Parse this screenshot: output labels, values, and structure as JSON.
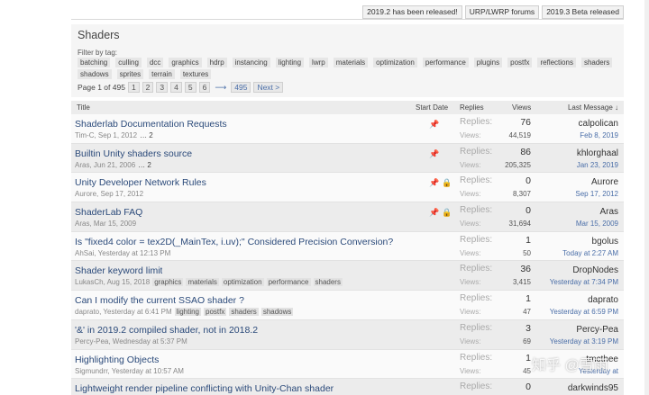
{
  "notices": [
    "2019.2 has been released!",
    "URP/LWRP forums",
    "2019.3 Beta released"
  ],
  "forum": {
    "title": "Shaders",
    "filter_label": "Filter by tag:",
    "tags": [
      "batching",
      "culling",
      "dcc",
      "graphics",
      "hdrp",
      "instancing",
      "lighting",
      "lwrp",
      "materials",
      "optimization",
      "performance",
      "plugins",
      "postfx",
      "reflections",
      "shaders",
      "shadows",
      "sprites",
      "terrain",
      "textures"
    ]
  },
  "pager": {
    "label": "Page 1 of 495",
    "pages": [
      "1",
      "2",
      "3",
      "4",
      "5",
      "6"
    ],
    "arrow": "⟶",
    "last": "495",
    "next": "Next >"
  },
  "columns": {
    "title": "Title",
    "start_date": "Start Date",
    "replies": "Replies",
    "views": "Views",
    "last_message": "Last Message ↓"
  },
  "labels": {
    "replies": "Replies:",
    "views": "Views:"
  },
  "threads": [
    {
      "title": "Shaderlab Documentation Requests",
      "meta": "Tim-C, Sep 1, 2012",
      "pages": "… 2",
      "tags": [],
      "pinned": true,
      "locked": false,
      "replies": "76",
      "views": "44,519",
      "last_user": "calpolican",
      "last_date": "Feb 8, 2019"
    },
    {
      "title": "Builtin Unity shaders source",
      "meta": "Aras, Jun 21, 2006",
      "pages": "… 2",
      "tags": [],
      "pinned": true,
      "locked": false,
      "replies": "86",
      "views": "205,325",
      "last_user": "khlorghaal",
      "last_date": "Jan 23, 2019"
    },
    {
      "title": "Unity Developer Network Rules",
      "meta": "Aurore, Sep 17, 2012",
      "pages": "",
      "tags": [],
      "pinned": true,
      "locked": true,
      "replies": "0",
      "views": "8,307",
      "last_user": "Aurore",
      "last_date": "Sep 17, 2012"
    },
    {
      "title": "ShaderLab FAQ",
      "meta": "Aras, Mar 15, 2009",
      "pages": "",
      "tags": [],
      "pinned": true,
      "locked": true,
      "replies": "0",
      "views": "31,694",
      "last_user": "Aras",
      "last_date": "Mar 15, 2009"
    },
    {
      "title": "Is \"fixed4 color = tex2D(_MainTex, i.uv);\" Considered Precision Conversion?",
      "meta": "AhSai, Yesterday at 12:13 PM",
      "pages": "",
      "tags": [],
      "pinned": false,
      "locked": false,
      "replies": "1",
      "views": "50",
      "last_user": "bgolus",
      "last_date": "Today at 2:27 AM"
    },
    {
      "title": "Shader keyword limit",
      "meta": "LukasCh, Aug 15, 2018",
      "pages": "",
      "tags": [
        "graphics",
        "materials",
        "optimization",
        "performance",
        "shaders"
      ],
      "pinned": false,
      "locked": false,
      "replies": "36",
      "views": "3,415",
      "last_user": "DropNodes",
      "last_date": "Yesterday at 7:34 PM"
    },
    {
      "title": "Can I modify the current SSAO shader ?",
      "meta": "daprato, Yesterday at 6:41 PM",
      "pages": "",
      "tags": [
        "lighting",
        "postfx",
        "shaders",
        "shadows"
      ],
      "pinned": false,
      "locked": false,
      "replies": "1",
      "views": "47",
      "last_user": "daprato",
      "last_date": "Yesterday at 6:59 PM"
    },
    {
      "title": "'&' in 2019.2 compiled shader, not in 2018.2",
      "meta": "Percy-Pea, Wednesday at 5:37 PM",
      "pages": "",
      "tags": [],
      "pinned": false,
      "locked": false,
      "replies": "3",
      "views": "69",
      "last_user": "Percy-Pea",
      "last_date": "Yesterday at 3:19 PM"
    },
    {
      "title": "Highlighting Objects",
      "meta": "Sigmundrr, Yesterday at 10:57 AM",
      "pages": "",
      "tags": [],
      "pinned": false,
      "locked": false,
      "replies": "1",
      "views": "45",
      "last_user": "tmcthee",
      "last_date": "Yesterday at"
    },
    {
      "title": "Lightweight render pipeline conflicting with Unity-Chan shader",
      "meta": "",
      "pages": "",
      "tags": [],
      "pinned": false,
      "locked": false,
      "replies": "0",
      "views": "",
      "last_user": "darkwinds95",
      "last_date": ""
    }
  ],
  "watermark": "知乎 @雪雨",
  "icons": {
    "pin": "pin-icon",
    "lock": "lock-icon"
  },
  "colors": {
    "link": "#2b4a7a",
    "date_link": "#4a6ea8",
    "pin": "#c14a3d",
    "lock": "#c8a01e"
  }
}
